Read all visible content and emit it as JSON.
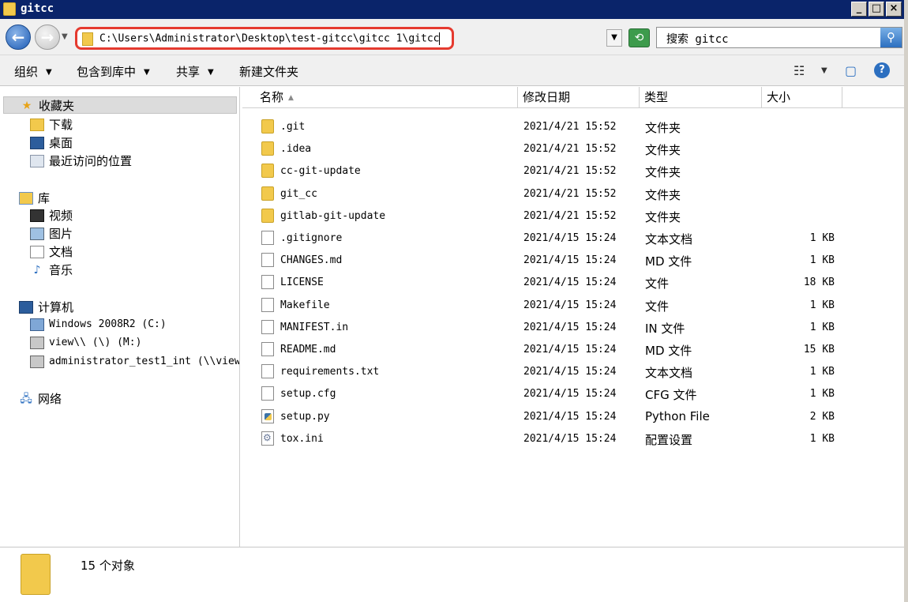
{
  "window": {
    "title": "gitcc",
    "btn_min": "_",
    "btn_max": "□",
    "btn_close": "×"
  },
  "address": {
    "path": "C:\\Users\\Administrator\\Desktop\\test-gitcc\\gitcc 1\\gitcc",
    "back_glyph": "←",
    "fwd_glyph": "→",
    "refresh_glyph": "⟲",
    "drop_glyph": "▼"
  },
  "search": {
    "placeholder": "搜索 gitcc",
    "btn_glyph": "⚲"
  },
  "toolbar": {
    "organize": "组织",
    "include_library": "包含到库中",
    "share": "共享",
    "new_folder": "新建文件夹",
    "dd_glyph": "▼",
    "view_glyph": "☷",
    "view_dd_glyph": "▼",
    "pane_glyph": "▢",
    "help_glyph": "?"
  },
  "sidebar": {
    "favorites": "收藏夹",
    "downloads": "下载",
    "desktop": "桌面",
    "recent": "最近访问的位置",
    "libraries": "库",
    "videos": "视频",
    "pictures": "图片",
    "documents": "文档",
    "music": "音乐",
    "computer": "计算机",
    "drive_c": "Windows 2008R2 (C:)",
    "drive_m": "view\\\\ (\\) (M:)",
    "drive_net": "administrator_test1_int (\\\\view",
    "network": "网络",
    "star_glyph": "★",
    "net_glyph": "🖧"
  },
  "columns": {
    "name": "名称",
    "date": "修改日期",
    "type": "类型",
    "size": "大小",
    "sort_glyph": "▲"
  },
  "files": [
    {
      "name": ".git",
      "date": "2021/4/21 15:52",
      "type": "文件夹",
      "size": ""
    },
    {
      "name": ".idea",
      "date": "2021/4/21 15:52",
      "type": "文件夹",
      "size": ""
    },
    {
      "name": "cc-git-update",
      "date": "2021/4/21 15:52",
      "type": "文件夹",
      "size": ""
    },
    {
      "name": "git_cc",
      "date": "2021/4/21 15:52",
      "type": "文件夹",
      "size": ""
    },
    {
      "name": "gitlab-git-update",
      "date": "2021/4/21 15:52",
      "type": "文件夹",
      "size": ""
    },
    {
      "name": ".gitignore",
      "date": "2021/4/15 15:24",
      "type": "文本文档",
      "size": "1 KB"
    },
    {
      "name": "CHANGES.md",
      "date": "2021/4/15 15:24",
      "type": "MD 文件",
      "size": "1 KB"
    },
    {
      "name": "LICENSE",
      "date": "2021/4/15 15:24",
      "type": "文件",
      "size": "18 KB"
    },
    {
      "name": "Makefile",
      "date": "2021/4/15 15:24",
      "type": "文件",
      "size": "1 KB"
    },
    {
      "name": "MANIFEST.in",
      "date": "2021/4/15 15:24",
      "type": "IN 文件",
      "size": "1 KB"
    },
    {
      "name": "README.md",
      "date": "2021/4/15 15:24",
      "type": "MD 文件",
      "size": "15 KB"
    },
    {
      "name": "requirements.txt",
      "date": "2021/4/15 15:24",
      "type": "文本文档",
      "size": "1 KB"
    },
    {
      "name": "setup.cfg",
      "date": "2021/4/15 15:24",
      "type": "CFG 文件",
      "size": "1 KB"
    },
    {
      "name": "setup.py",
      "date": "2021/4/15 15:24",
      "type": "Python File",
      "size": "2 KB"
    },
    {
      "name": "tox.ini",
      "date": "2021/4/15 15:24",
      "type": "配置设置",
      "size": "1 KB"
    }
  ],
  "status": {
    "count": "15 个对象"
  }
}
